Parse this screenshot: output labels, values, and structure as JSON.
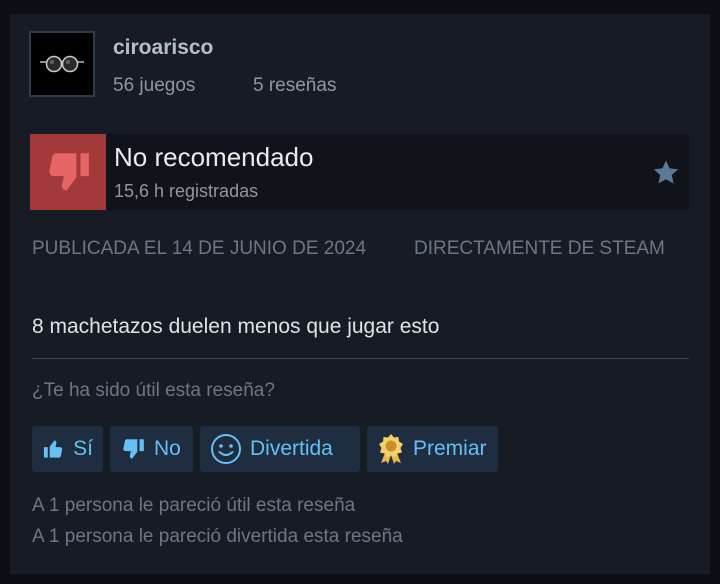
{
  "user": {
    "name": "ciroarisco",
    "games": "56 juegos",
    "reviews": "5 reseñas"
  },
  "review": {
    "verdict": "No recomendado",
    "hours": "15,6 h registradas",
    "verdict_color": "#a33a3a",
    "published": "PUBLICADA EL 14 DE JUNIO DE 2024",
    "source": "DIRECTAMENTE DE STEAM",
    "text": "8 machetazos duelen menos que jugar esto"
  },
  "feedback": {
    "question": "¿Te ha sido útil esta reseña?",
    "buttons": {
      "yes": "Sí",
      "no": "No",
      "funny": "Divertida",
      "award": "Premiar"
    },
    "stat_helpful": "A 1 persona le pareció útil esta reseña",
    "stat_funny": "A 1 persona le pareció divertida esta reseña"
  },
  "icons": {
    "avatar": "round-glasses-avatar",
    "verdict": "thumbs-down-icon",
    "favorite": "star-icon",
    "yes": "thumbs-up-icon",
    "no": "thumbs-down-icon",
    "funny": "smiley-icon",
    "award": "award-icon"
  }
}
